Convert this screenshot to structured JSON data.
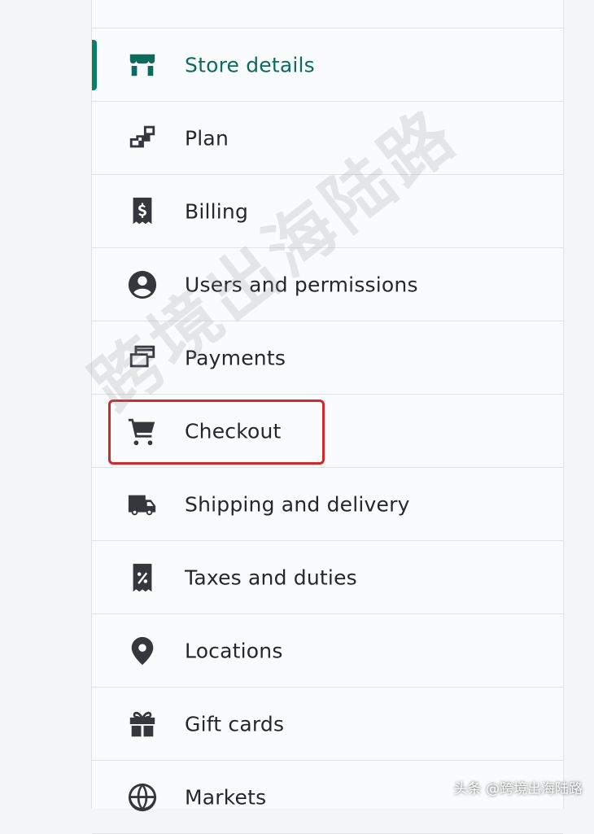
{
  "settings_nav": {
    "items": [
      {
        "label": "Store details",
        "icon": "store-icon",
        "active": true
      },
      {
        "label": "Plan",
        "icon": "plan-icon"
      },
      {
        "label": "Billing",
        "icon": "billing-icon"
      },
      {
        "label": "Users and permissions",
        "icon": "user-icon"
      },
      {
        "label": "Payments",
        "icon": "payments-icon"
      },
      {
        "label": "Checkout",
        "icon": "cart-icon",
        "highlighted": true
      },
      {
        "label": "Shipping and delivery",
        "icon": "truck-icon"
      },
      {
        "label": "Taxes and duties",
        "icon": "tax-icon"
      },
      {
        "label": "Locations",
        "icon": "location-pin-icon"
      },
      {
        "label": "Gift cards",
        "icon": "gift-icon"
      },
      {
        "label": "Markets",
        "icon": "globe-icon"
      }
    ]
  },
  "watermark": "跨境出海陆路",
  "credit": "头条 @跨境出海陆路",
  "colors": {
    "accent": "#0b6b5c",
    "highlight_box": "#d4272a"
  }
}
